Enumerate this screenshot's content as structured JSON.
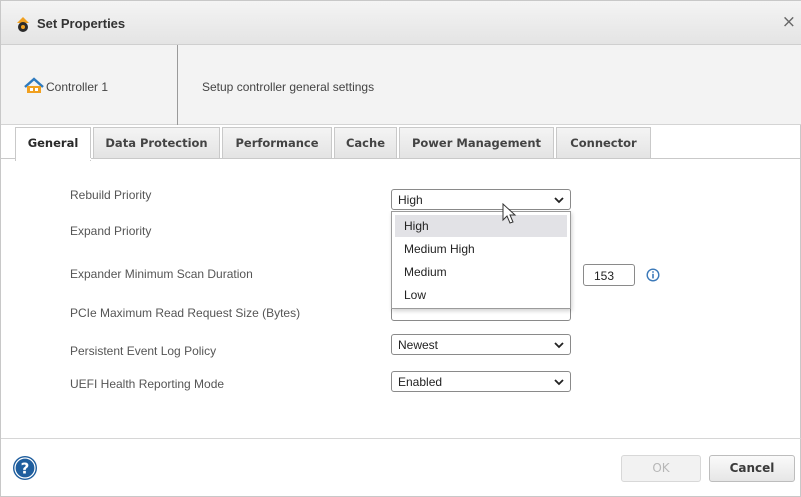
{
  "window": {
    "title": "Set Properties",
    "close_glyph": "×"
  },
  "header": {
    "controller_name": "Controller 1",
    "description": "Setup controller general settings"
  },
  "tabs": [
    {
      "label": "General",
      "active": true
    },
    {
      "label": "Data Protection",
      "active": false
    },
    {
      "label": "Performance",
      "active": false
    },
    {
      "label": "Cache",
      "active": false
    },
    {
      "label": "Power Management",
      "active": false
    },
    {
      "label": "Connector",
      "active": false
    }
  ],
  "settings": {
    "rebuild_priority": {
      "label": "Rebuild Priority",
      "value": "High"
    },
    "expand_priority": {
      "label": "Expand Priority"
    },
    "expander_scan": {
      "label": "Expander Minimum Scan Duration",
      "value": "153"
    },
    "pcie_read": {
      "label": "PCIe Maximum Read Request Size (Bytes)"
    },
    "event_log": {
      "label": "Persistent Event Log Policy",
      "value": "Newest"
    },
    "uefi_health": {
      "label": "UEFI Health Reporting Mode",
      "value": "Enabled"
    }
  },
  "dropdown": {
    "options": [
      "High",
      "Medium High",
      "Medium",
      "Low"
    ],
    "highlighted": "High"
  },
  "footer": {
    "ok_label": "OK",
    "cancel_label": "Cancel"
  },
  "colors": {
    "accent_orange": "#f0a020",
    "help_blue": "#1f5e9e",
    "info_blue": "#3a78b8"
  },
  "icons": [
    "settings-gear-icon",
    "controller-icon",
    "chevron-down-icon",
    "info-icon",
    "help-icon",
    "mouse-cursor-icon"
  ]
}
